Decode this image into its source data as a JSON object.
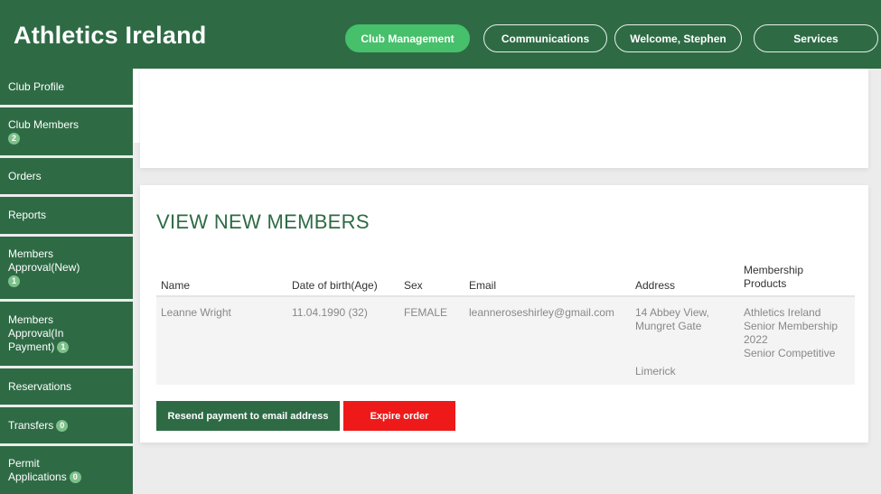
{
  "header": {
    "brand": "Athletics Ireland",
    "nav": [
      {
        "label": "Club Management",
        "active": true
      },
      {
        "label": "Communications",
        "active": false
      },
      {
        "label": "Welcome, Stephen",
        "active": false
      },
      {
        "label": "Services",
        "active": false
      }
    ]
  },
  "sidebar": {
    "items": [
      {
        "label": "Club Profile"
      },
      {
        "label": "Club Members",
        "badge": "2"
      },
      {
        "label": "Orders"
      },
      {
        "label": "Reports"
      },
      {
        "label_line1": "Members",
        "label_line2": "Approval(New)",
        "badge": "1"
      },
      {
        "label_line1": "Members",
        "label_line2": "Approval(In",
        "label_line3": "Payment)",
        "badge": "1"
      },
      {
        "label": "Reservations"
      },
      {
        "label": "Transfers",
        "badge": "0"
      },
      {
        "label_line1": "Permit",
        "label_line2": "Applications",
        "badge": "0"
      }
    ]
  },
  "main": {
    "title": "VIEW NEW MEMBERS",
    "table": {
      "headers": {
        "name": "Name",
        "dob": "Date of birth(Age)",
        "sex": "Sex",
        "email": "Email",
        "address": "Address",
        "products_line1": "Membership",
        "products_line2": "Products"
      },
      "rows": [
        {
          "name": "Leanne Wright",
          "dob": "11.04.1990 (32)",
          "sex": "FEMALE",
          "email": "leanneroseshirley@gmail.com",
          "address_line1": "14 Abbey View,",
          "address_line2": "Mungret Gate",
          "address_line3": "Limerick",
          "products_line1": "Athletics Ireland",
          "products_line2": "Senior Membership",
          "products_line3": "2022",
          "products_line4": "Senior Competitive"
        }
      ]
    },
    "buttons": {
      "resend": "Resend payment to email address",
      "expire": "Expire order"
    }
  },
  "colors": {
    "brand_green": "#2e6b45",
    "active_pill": "#46c06a",
    "danger": "#ee1a1a",
    "title_green": "#2e6b45"
  }
}
